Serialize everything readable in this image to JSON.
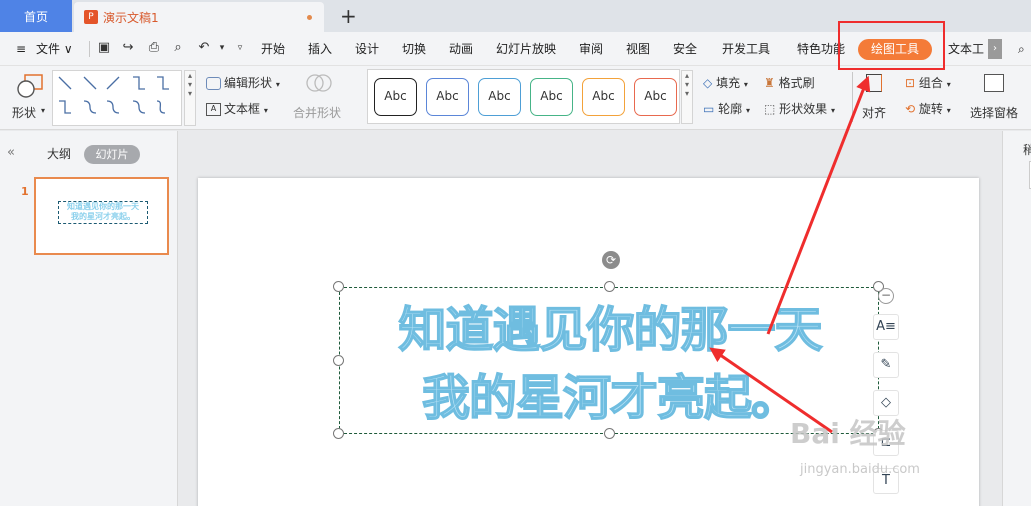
{
  "tabs": {
    "home": "首页",
    "doc": "演示文稿1",
    "doc_badge": "P"
  },
  "menu": {
    "file": "文件",
    "items": [
      "开始",
      "插入",
      "设计",
      "切换",
      "动画",
      "幻灯片放映",
      "审阅",
      "视图",
      "安全",
      "开发工具",
      "特色功能"
    ],
    "draw_tools": "绘图工具",
    "text_tools": "文本工"
  },
  "ribbon": {
    "shape": "形状",
    "edit_shape": "编辑形状",
    "text_box": "文本框",
    "merge_shape": "合并形状",
    "style_samples": [
      "Abc",
      "Abc",
      "Abc",
      "Abc",
      "Abc",
      "Abc"
    ],
    "style_colors": [
      "#222222",
      "#5b86d8",
      "#4e9fd6",
      "#46b487",
      "#f3a23a",
      "#e8694e"
    ],
    "fill": "填充",
    "format_painter": "格式刷",
    "outline": "轮廓",
    "shape_effect": "形状效果",
    "align": "对齐",
    "group": "组合",
    "rotate": "旋转",
    "select_pane": "选择窗格"
  },
  "panel": {
    "outline_tab": "大纲",
    "slides_tab": "幻灯片",
    "slide_number": "1",
    "thumb_line1": "知道遇见你的那一天",
    "thumb_line2": "我的星河才亮起。"
  },
  "slide": {
    "line1": "知道遇见你的那一天",
    "line2": "我的星河才亮起。"
  },
  "right_panel": {
    "label": "稍"
  },
  "watermark": {
    "brand": "Bai 经验",
    "url": "jingyan.baidu.com"
  },
  "colors": {
    "accent": "#f47b38",
    "annotation_red": "#ef2d2d",
    "text_fill": "#b7e2f6",
    "text_stroke": "#6fbde0",
    "home_tab": "#4f83e6"
  }
}
